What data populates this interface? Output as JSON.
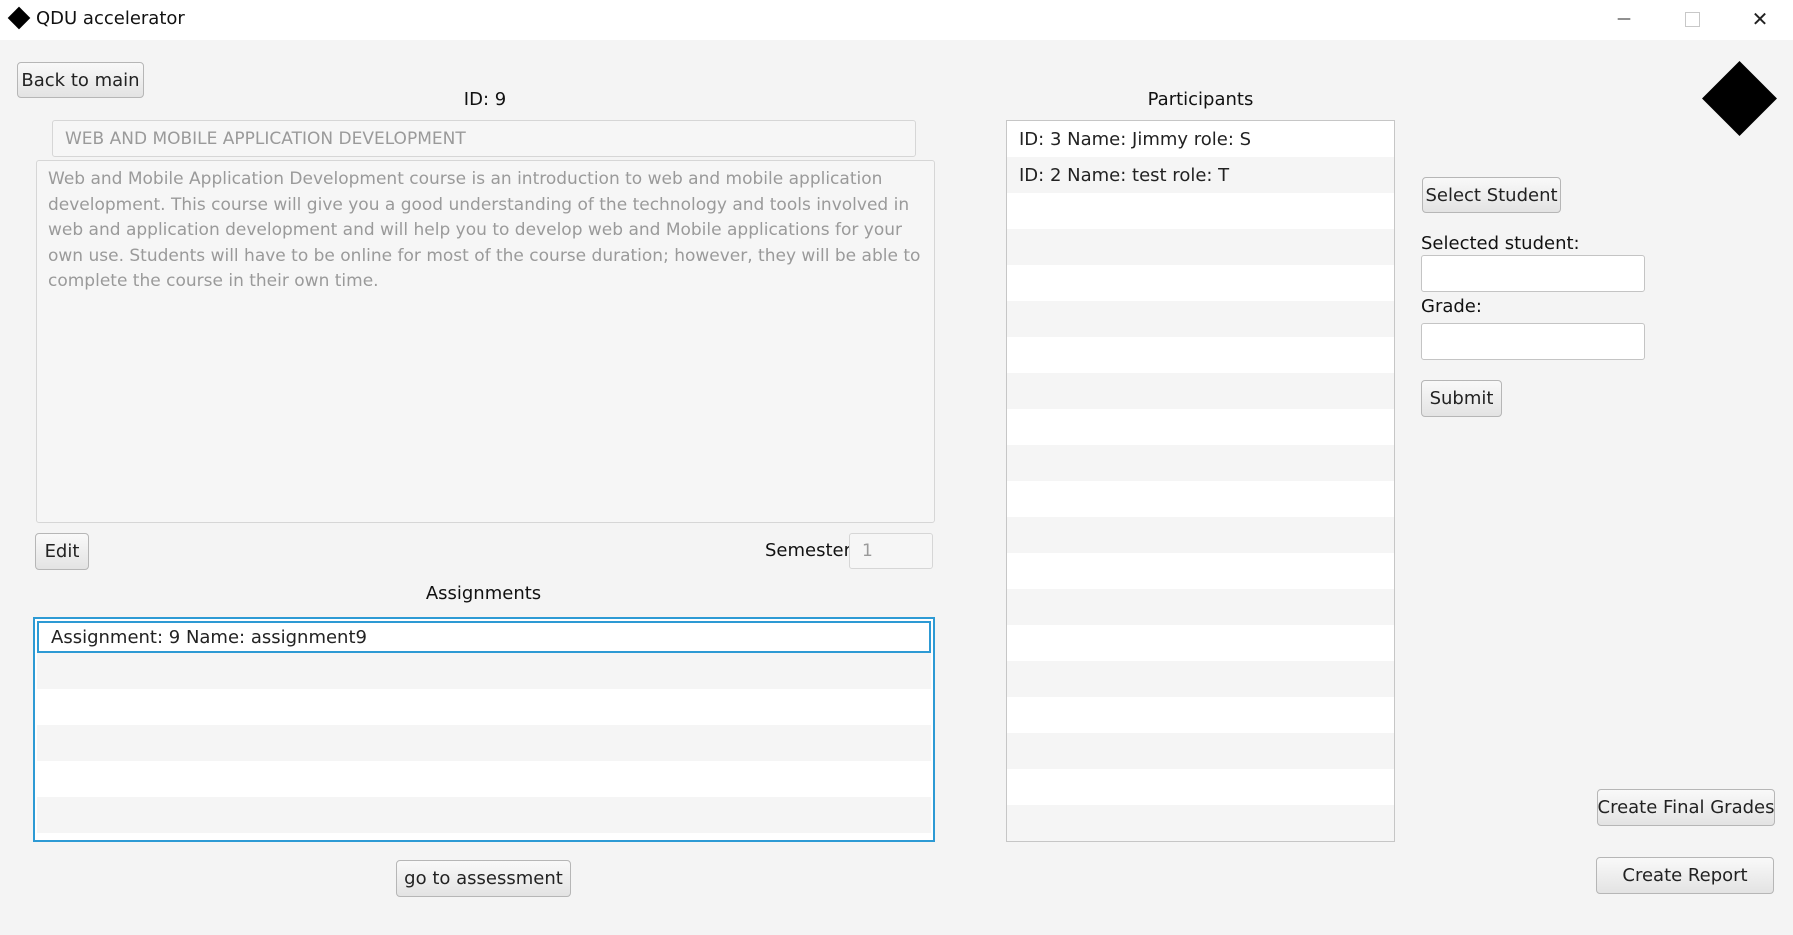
{
  "window": {
    "title": "QDU accelerator",
    "minimize_glyph": "—",
    "close_glyph": "✕"
  },
  "course": {
    "back_label": "Back to main",
    "id_label": "ID: 9",
    "title_value": "WEB AND MOBILE APPLICATION DEVELOPMENT",
    "description": "Web and Mobile Application Development course is an introduction to web and mobile application development. This course will give you a good understanding of the technology and tools involved in web and application development and will help you to develop web and Mobile applications for your own use. Students will have to be online for most of the course duration; however, they will be able to complete the course in their own time.",
    "edit_label": "Edit",
    "semester_label": "Semester:",
    "semester_value": "1"
  },
  "assignments": {
    "header": "Assignments",
    "items": [
      "Assignment: 9 Name: assignment9",
      "",
      "",
      "",
      "",
      ""
    ],
    "go_label": "go to assessment"
  },
  "participants": {
    "header": "Participants",
    "items": [
      "ID: 3 Name: Jimmy role: S",
      "ID: 2 Name: test role: T",
      "",
      "",
      "",
      "",
      "",
      "",
      "",
      "",
      "",
      "",
      "",
      "",
      "",
      "",
      "",
      "",
      "",
      ""
    ]
  },
  "grading": {
    "select_label": "Select Student",
    "selected_label": "Selected student:",
    "selected_value": "",
    "grade_label": "Grade:",
    "grade_value": "",
    "submit_label": "Submit"
  },
  "actions": {
    "final_grades_label": "Create Final Grades",
    "report_label": "Create Report"
  },
  "colors": {
    "focus": "#2d9ad4",
    "logo": "#000000"
  }
}
